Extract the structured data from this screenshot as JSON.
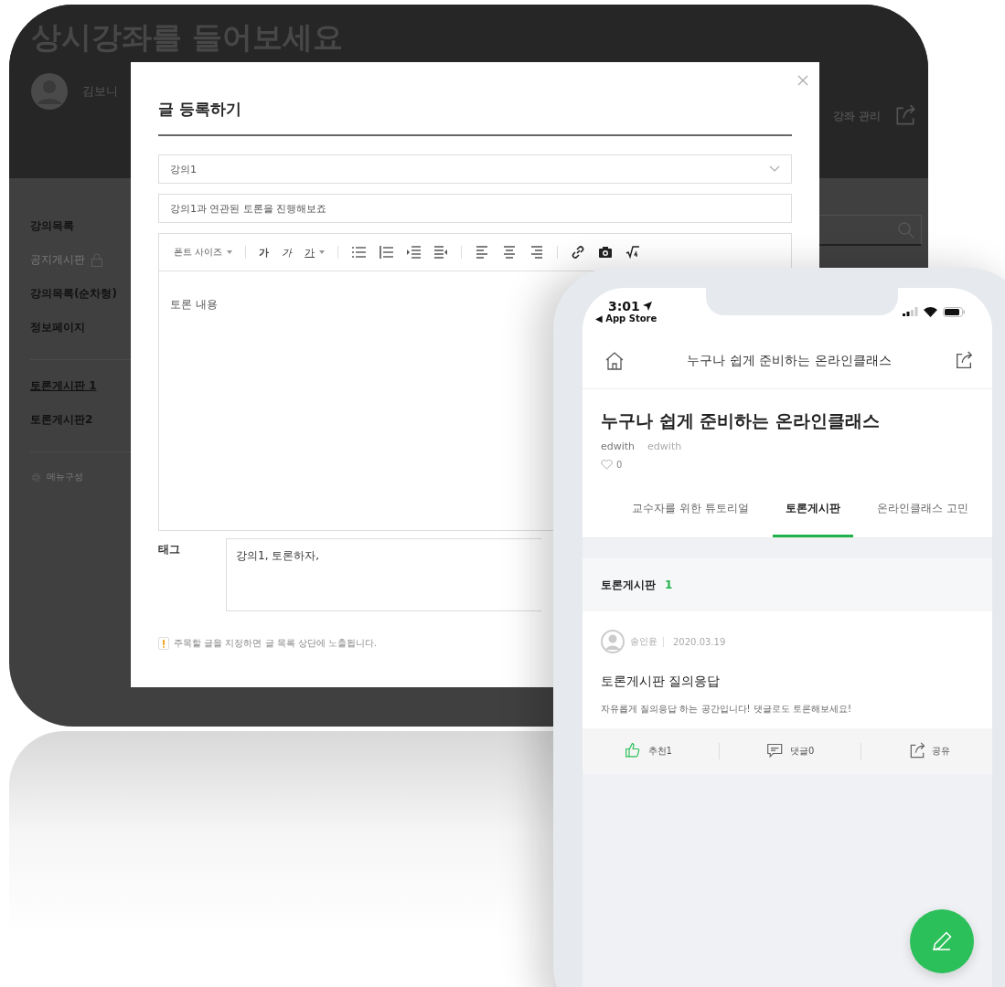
{
  "desktop": {
    "page_title": "상시강좌를 들어보세요",
    "user_name": "김보니",
    "manage_link": "강좌 관리",
    "sidebar": {
      "groups": [
        [
          {
            "label": "강의목록",
            "selected": false,
            "disabled": false,
            "locked": false
          },
          {
            "label": "공지게시판",
            "selected": false,
            "disabled": true,
            "locked": true
          },
          {
            "label": "강의목록(순차형)",
            "selected": false,
            "disabled": false,
            "locked": false
          },
          {
            "label": "정보페이지",
            "selected": false,
            "disabled": false,
            "locked": false
          }
        ],
        [
          {
            "label": "토론게시판 1",
            "selected": true,
            "disabled": false,
            "locked": false
          },
          {
            "label": "토론게시판2",
            "selected": false,
            "disabled": false,
            "locked": false
          }
        ]
      ],
      "menu_config": "메뉴구성"
    }
  },
  "modal": {
    "title": "글 등록하기",
    "lecture_select": {
      "value": "강의1"
    },
    "title_field": {
      "value": "강의1과 연관된 토론을 진행해보죠"
    },
    "toolbar": {
      "font_size": "폰트 사이즈",
      "styles": [
        {
          "kind": "bold",
          "label": "가"
        },
        {
          "kind": "italic",
          "label": "가"
        },
        {
          "kind": "underline",
          "label": "가"
        }
      ]
    },
    "editor": {
      "value": "토론 내용"
    },
    "tags": {
      "label": "태그",
      "value": "강의1, 토론하자,"
    },
    "notice": "주목할 글을 지정하면 글 목록 상단에 노출됩니다."
  },
  "phone": {
    "status_bar": {
      "time": "3:01",
      "back": "◀ App Store"
    },
    "nav_title": "누구나 쉽게 준비하는 온라인클래스",
    "course": {
      "title": "누구나 쉽게 준비하는 온라인클래스",
      "authors": [
        "edwith",
        "edwith"
      ],
      "likes": "0"
    },
    "tabs": [
      {
        "label": "교수자를 위한 튜토리얼",
        "selected": false
      },
      {
        "label": "토론게시판",
        "selected": true
      },
      {
        "label": "온라인클래스 고민",
        "selected": false
      }
    ],
    "board": {
      "title": "토론게시판",
      "count": "1"
    },
    "posts": [
      {
        "author": "송인윤",
        "date": "2020.03.19",
        "title": "토론게시판 질의응답",
        "body": "자유롭게 질의응답 하는 공간입니다! 댓글로도 토론해보세요!",
        "actions": [
          {
            "kind": "like",
            "label": "추천1",
            "active": true
          },
          {
            "kind": "comment",
            "label": "댓글0",
            "active": false
          },
          {
            "kind": "share",
            "label": "공유",
            "active": false
          }
        ]
      }
    ]
  }
}
